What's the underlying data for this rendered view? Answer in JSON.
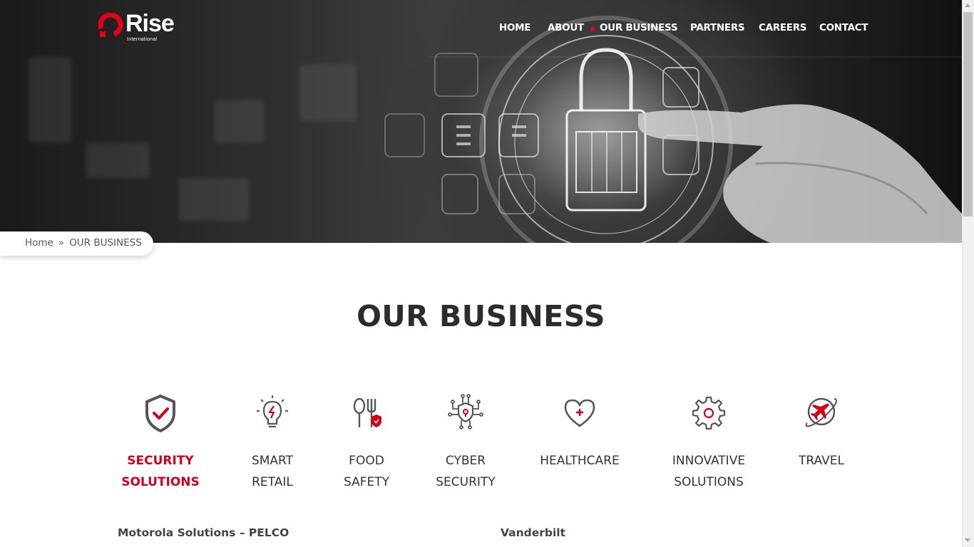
{
  "header": {
    "logo_word": "Rise",
    "logo_sub": "International",
    "nav": [
      {
        "label": "HOME"
      },
      {
        "label": "ABOUT"
      },
      {
        "label": "OUR BUSINESS"
      },
      {
        "label": "PARTNERS"
      },
      {
        "label": "CAREERS"
      },
      {
        "label": "CONTACT"
      }
    ],
    "active_nav": "OUR BUSINESS"
  },
  "breadcrumb": {
    "home": "Home",
    "separator": "»",
    "current": "OUR BUSINESS"
  },
  "page_title": "OUR BUSINESS",
  "categories": [
    {
      "label": "SECURITY\nSOLUTIONS",
      "icon": "shield-check-icon",
      "active": true
    },
    {
      "label": "SMART\nRETAIL",
      "icon": "lightbulb-icon",
      "active": false
    },
    {
      "label": "FOOD\nSAFETY",
      "icon": "fork-spoon-shield-icon",
      "active": false
    },
    {
      "label": "CYBER\nSECURITY",
      "icon": "circuit-shield-icon",
      "active": false
    },
    {
      "label": "HEALTHCARE",
      "icon": "heart-plus-icon",
      "active": false
    },
    {
      "label": "INNOVATIVE\nSOLUTIONS",
      "icon": "gear-icon",
      "active": false
    },
    {
      "label": "TRAVEL",
      "icon": "airplane-globe-icon",
      "active": false
    }
  ],
  "brands": {
    "left": "Motorola Solutions – PELCO",
    "right": "Vanderbilt"
  },
  "colors": {
    "accent": "#d4001a",
    "title": "#2c2c2c",
    "icon_gray": "#555555"
  }
}
